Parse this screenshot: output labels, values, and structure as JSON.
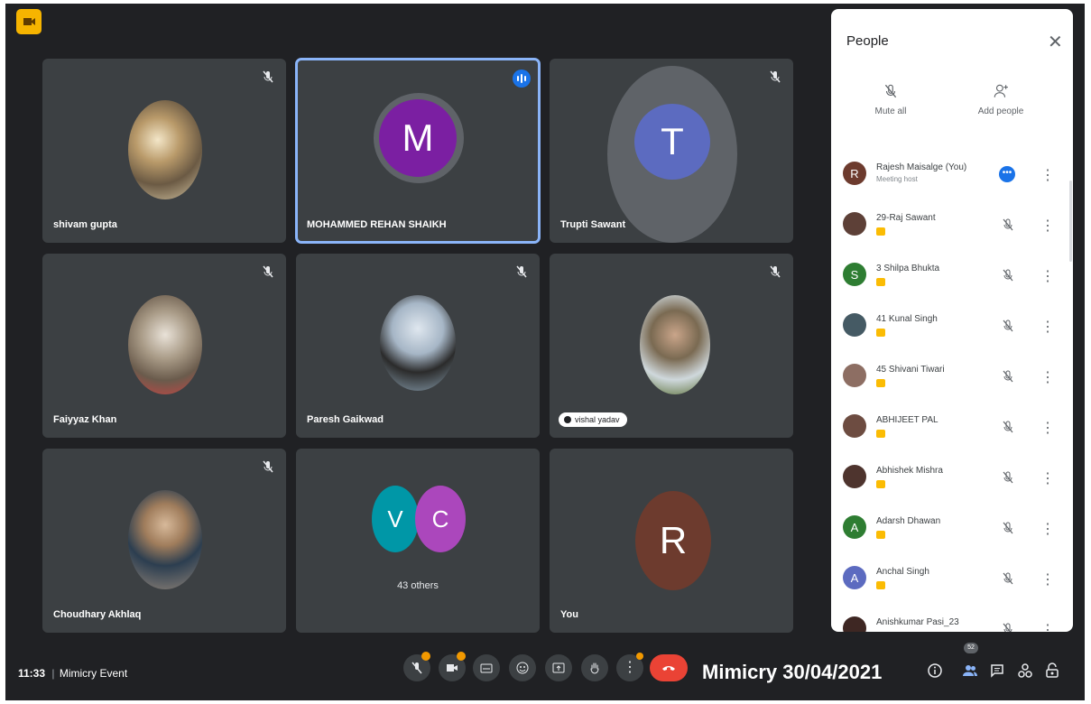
{
  "meeting": {
    "time": "11:33",
    "separator": "|",
    "name": "Mimicry Event"
  },
  "overlay_text": "Mimicry 30/04/2021",
  "tiles": [
    {
      "name": "shivam gupta",
      "type": "photo"
    },
    {
      "name": "MOHAMMED REHAN SHAIKH",
      "type": "letter",
      "letter": "M",
      "color": "#7b1fa2",
      "speaking": true
    },
    {
      "name": "Trupti Sawant",
      "type": "letter",
      "letter": "T",
      "color": "#5c6bc0"
    },
    {
      "name": "Faiyyaz Khan",
      "type": "photo"
    },
    {
      "name": "Paresh Gaikwad",
      "type": "photo"
    },
    {
      "name": "vishal yadav",
      "type": "photo"
    },
    {
      "name": "Choudhary Akhlaq",
      "type": "photo"
    },
    {
      "name": "43 others",
      "type": "group",
      "letters": [
        "V",
        "C"
      ],
      "colors": [
        "#0097a7",
        "#ab47bc"
      ]
    },
    {
      "name": "You",
      "type": "letter",
      "letter": "R",
      "color": "#6d3b2e"
    }
  ],
  "people_panel": {
    "title": "People",
    "close_icon": "close-icon",
    "actions": [
      {
        "label": "Mute all"
      },
      {
        "label": "Add people"
      }
    ],
    "participants": [
      {
        "name": "Rajesh Maisalge (You)",
        "sub": "Meeting host",
        "initial": "R",
        "color": "#6d3b2e"
      },
      {
        "name": "29-Raj Sawant",
        "initial": "",
        "color": "#5d4037"
      },
      {
        "name": "3 Shilpa Bhukta",
        "initial": "S",
        "color": "#2e7d32"
      },
      {
        "name": "41 Kunal Singh",
        "initial": "",
        "color": "#455a64"
      },
      {
        "name": "45 Shivani Tiwari",
        "initial": "",
        "color": "#8d6e63"
      },
      {
        "name": "ABHIJEET PAL",
        "initial": "",
        "color": "#6d4c41"
      },
      {
        "name": "Abhishek Mishra",
        "initial": "",
        "color": "#4e342e"
      },
      {
        "name": "Adarsh Dhawan",
        "initial": "A",
        "color": "#2e7d32"
      },
      {
        "name": "Anchal Singh",
        "initial": "A",
        "color": "#5c6bc0"
      },
      {
        "name": "Anishkumar Pasi_23",
        "initial": "",
        "color": "#3e2723"
      }
    ]
  },
  "people_count": "52",
  "colors": {
    "background": "#202124",
    "tile": "#3c4043",
    "accent": "#8ab4f8",
    "hangup": "#ea4335",
    "badge": "#f29900"
  }
}
